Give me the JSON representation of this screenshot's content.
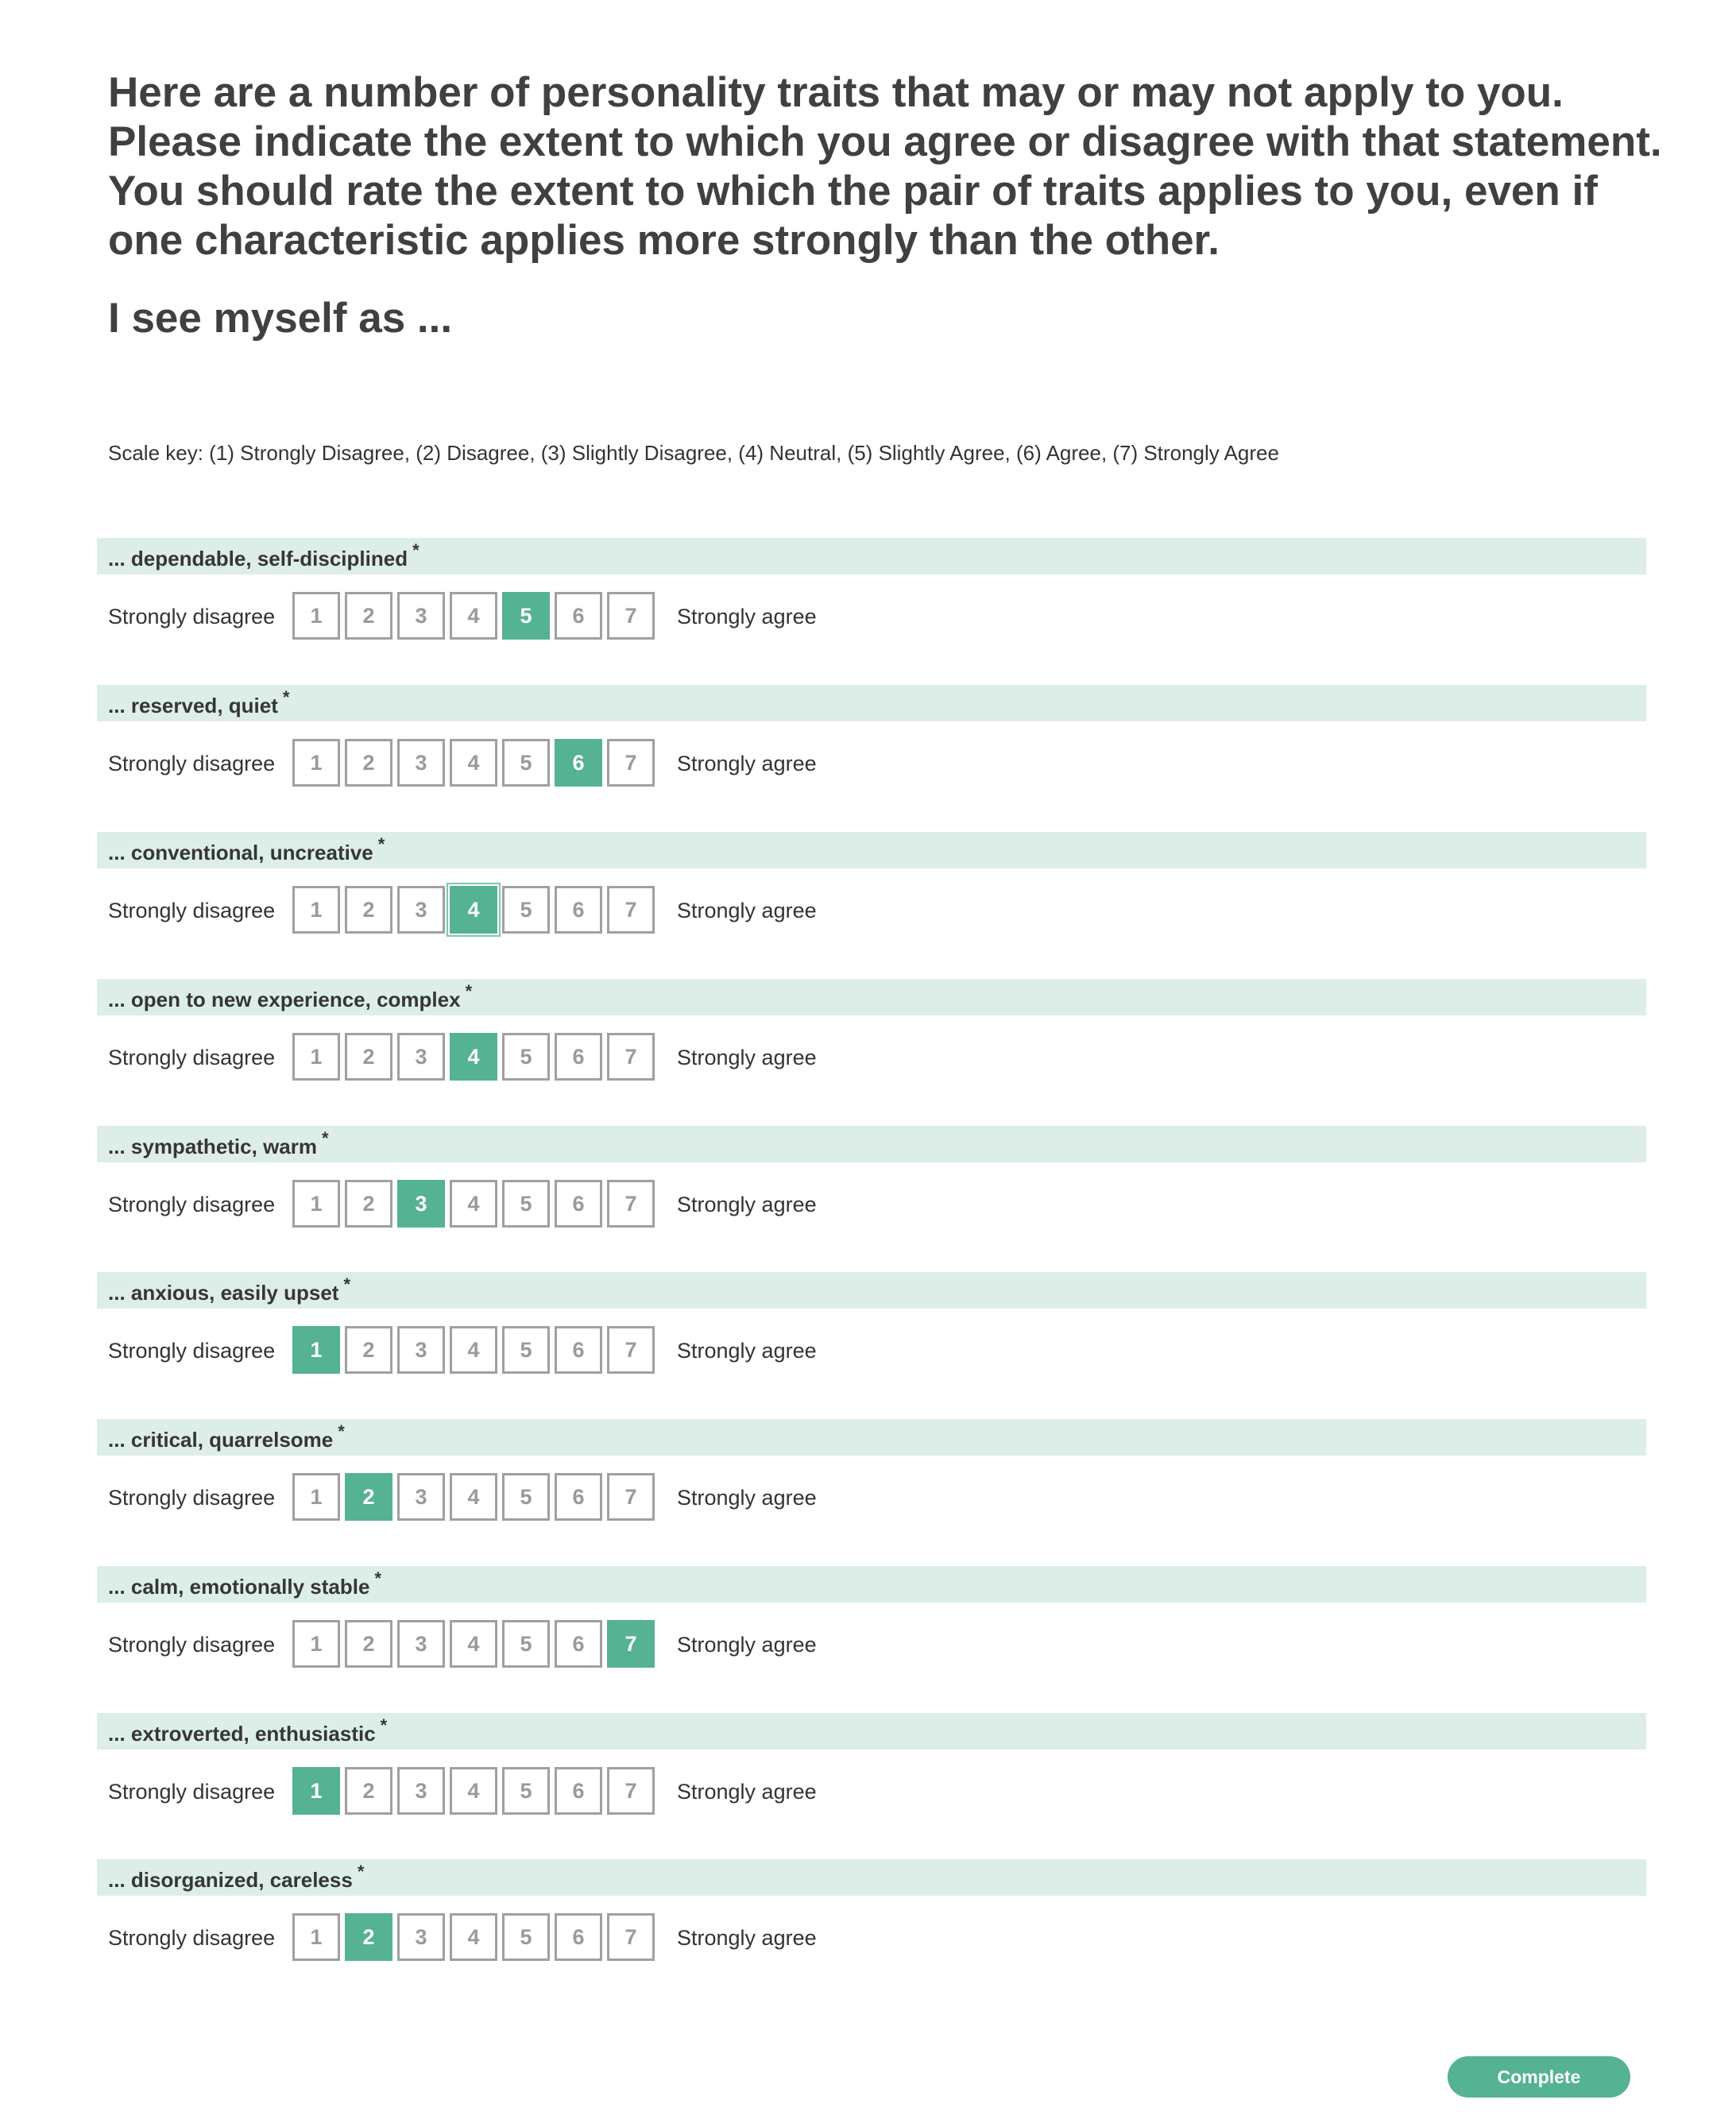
{
  "intro": {
    "text": "Here are a number of personality traits that may or may not apply to you. Please indicate the extent to which you agree or disagree with that statement. You should rate the extent to which the pair of traits applies to you, even if one characteristic applies more strongly than the other.",
    "subheading": "I see myself as ..."
  },
  "scale_key": "Scale key: (1) Strongly Disagree, (2) Disagree, (3) Slightly Disagree, (4) Neutral, (5) Slightly Agree, (6) Agree, (7) Strongly Agree",
  "anchors": {
    "left": "Strongly disagree",
    "right": "Strongly agree"
  },
  "required_marker": "*",
  "options": [
    "1",
    "2",
    "3",
    "4",
    "5",
    "6",
    "7"
  ],
  "questions": [
    {
      "label": "... dependable, self-disciplined",
      "selected": 5
    },
    {
      "label": "... reserved, quiet",
      "selected": 6
    },
    {
      "label": "... conventional, uncreative",
      "selected": 4,
      "focused": true
    },
    {
      "label": "... open to new experience, complex",
      "selected": 4
    },
    {
      "label": "... sympathetic, warm",
      "selected": 3
    },
    {
      "label": "... anxious, easily upset",
      "selected": 1
    },
    {
      "label": "... critical, quarrelsome",
      "selected": 2
    },
    {
      "label": "... calm, emotionally stable",
      "selected": 7
    },
    {
      "label": "... extroverted, enthusiastic",
      "selected": 1
    },
    {
      "label": "... disorganized, careless",
      "selected": 2
    }
  ],
  "complete_button": "Complete",
  "colors": {
    "accent": "#55b293",
    "header_band": "#ddeee9",
    "option_border": "#a0a0a0"
  }
}
